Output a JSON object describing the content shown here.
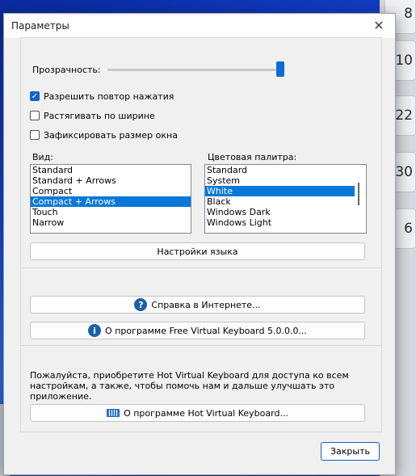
{
  "background_keys": [
    "8",
    "10",
    "22",
    "30",
    "6"
  ],
  "window": {
    "title": "Параметры",
    "close_icon": "close-icon"
  },
  "transparency": {
    "label": "Прозрачность:",
    "level_percent": 100
  },
  "checkboxes": [
    {
      "label": "Разрешить повтор нажатия",
      "checked": true
    },
    {
      "label": "Растягивать по ширине",
      "checked": false
    },
    {
      "label": "Зафиксировать размер окна",
      "checked": false
    }
  ],
  "view": {
    "label": "Вид:",
    "items": [
      "Standard",
      "Standard + Arrows",
      "Compact",
      "Compact + Arrows",
      "Touch",
      "Narrow"
    ],
    "selected_index": 3
  },
  "palette": {
    "label": "Цветовая палитра:",
    "items": [
      "Standard",
      "System",
      "White",
      "Black",
      "Windows Dark",
      "Windows Light"
    ],
    "selected_index": 2
  },
  "buttons": {
    "language_settings": "Настройки языка",
    "online_help": "Справка в Интернете...",
    "about_free": "О программе Free Virtual Keyboard 5.0.0.0...",
    "about_hot": "О программе Hot Virtual Keyboard...",
    "close": "Закрыть"
  },
  "notice_text": "Пожалуйста, приобретите Hot Virtual Keyboard для доступа ко всем настройкам, а также, чтобы помочь нам и дальше улучшать это приложение.",
  "colors": {
    "accent": "#0a78d7",
    "slider": "#0b6cd6",
    "info_icon": "#1c5fa8"
  }
}
